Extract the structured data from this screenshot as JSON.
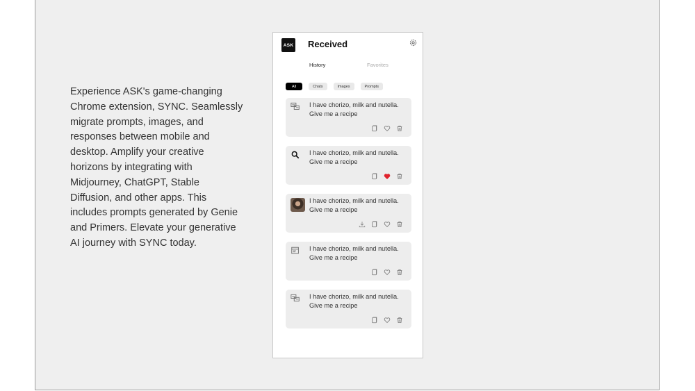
{
  "description": "Experience ASK's game-changing Chrome extension, SYNC. Seamlessly migrate prompts, images, and responses between mobile and desktop. Amplify your creative horizons by integrating with Midjourney, ChatGPT, Stable Diffusion, and other apps. This includes prompts generated by Genie and Primers. Elevate your generative AI journey with SYNC today.",
  "panel": {
    "logo_text": "ASK",
    "title": "Received",
    "tabs": [
      "History",
      "Favorites"
    ],
    "filters": [
      "All",
      "Chats",
      "Images",
      "Prompts"
    ],
    "items": [
      {
        "text": "I have chorizo, milk and nutella. Give me a recipe",
        "icon": "chat-translate-icon"
      },
      {
        "text": "I have chorizo, milk and nutella. Give me a recipe",
        "icon": "search-icon"
      },
      {
        "text": "I have chorizo, milk and nutella. Give me a recipe",
        "icon": "image-thumbnail"
      },
      {
        "text": "I have chorizo, milk and nutella. Give me a recipe",
        "icon": "window-icon"
      },
      {
        "text": "I have chorizo, milk and nutella. Give me a recipe",
        "icon": "chat-translate-icon"
      }
    ],
    "colors": {
      "favorite_active": "#e0242e",
      "accent": "#000000",
      "card_bg": "#ededed"
    }
  }
}
